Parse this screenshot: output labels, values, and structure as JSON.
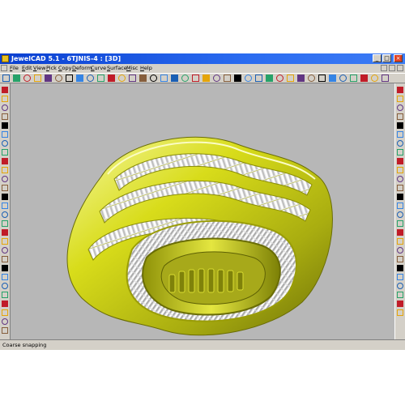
{
  "window": {
    "title": "JewelCAD 5.1 - 6TJNIS-4 : [3D]",
    "min_glyph": "_",
    "max_glyph": "□",
    "close_glyph": "×"
  },
  "menu": {
    "items": [
      "File",
      "Edit",
      "View",
      "Pick",
      "Copy",
      "Deform",
      "Curve",
      "Surface",
      "Misc",
      "Help"
    ]
  },
  "toolbar": {
    "icons": [
      "new-file-icon",
      "open-file-icon",
      "save-icon",
      "print-icon",
      "undo-icon",
      "redo-icon",
      "pick-icon",
      "zoom-cross-icon",
      "move-icon",
      "rotate-icon",
      "scale-icon",
      "mirror-icon",
      "render-icon",
      "wireframe-icon",
      "shade-icon",
      "view-top-icon",
      "view-front-icon",
      "view-side-icon",
      "view-3d-icon",
      "layer-icon",
      "grid-icon",
      "snap-icon",
      "axis-icon",
      "measure-icon",
      "zoom-in-icon",
      "zoom-out-icon",
      "zoom-window-icon",
      "zoom-all-icon",
      "pan-icon",
      "fit-icon",
      "orbit-icon",
      "color-icon",
      "material-icon",
      "light-icon",
      "camera-icon",
      "export-icon",
      "help-icon"
    ]
  },
  "left_toolbar": {
    "icons": [
      "point-icon",
      "line-icon",
      "arc-icon",
      "circle-icon",
      "polyline-icon",
      "spline-icon",
      "box-icon",
      "sphere-icon",
      "cylinder-icon",
      "cone-icon",
      "torus-icon",
      "extrude-icon",
      "revolve-icon",
      "sweep-icon",
      "loft-icon",
      "gem-icon",
      "prong-icon",
      "bezel-icon",
      "ring-icon",
      "shank-icon",
      "boolean-union-icon",
      "boolean-subtract-icon",
      "boolean-intersect-icon",
      "fillet-icon",
      "chamfer-icon",
      "shell-icon",
      "array-icon",
      "stone-set-icon"
    ]
  },
  "right_toolbar": {
    "icons": [
      "select-icon",
      "deselect-icon",
      "hide-icon",
      "show-icon",
      "lock-icon",
      "unlock-icon",
      "group-icon",
      "ungroup-icon",
      "align-icon",
      "distribute-icon",
      "trim-icon",
      "extend-icon",
      "split-icon",
      "join-icon",
      "offset-icon",
      "project-icon",
      "twist-icon",
      "bend-icon",
      "taper-icon",
      "stretch-icon",
      "warp-icon",
      "morph-icon",
      "flatten-icon",
      "weight-icon",
      "volume-icon",
      "info-icon"
    ]
  },
  "viewport": {
    "background_color": "#b7b7b7",
    "model": "gold-ring-with-baguette-stones",
    "metal_color": "#d8dc1a",
    "stone_color": "#f2f2f2"
  },
  "status": {
    "text": "Coarse snapping"
  }
}
